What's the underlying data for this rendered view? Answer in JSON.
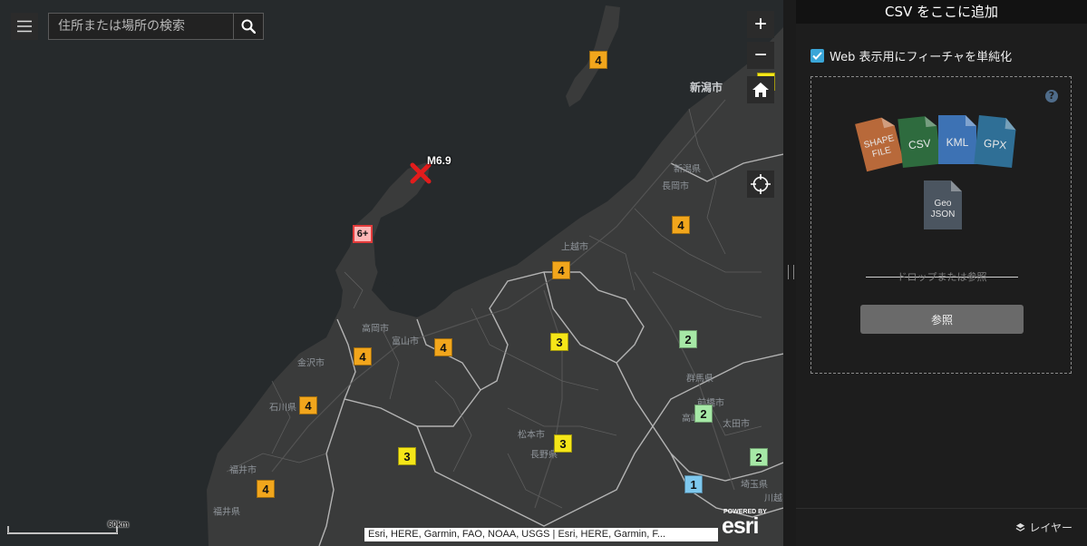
{
  "search": {
    "placeholder": "住所または場所の検索"
  },
  "zoom": {
    "in_label": "+",
    "out_label": "−"
  },
  "earthquake": {
    "magnitude_label": "M6.9"
  },
  "places": [
    {
      "key": "niigata-city",
      "label": "新潟市",
      "big": true
    },
    {
      "key": "niigata-pref",
      "label": "新潟県",
      "big": false
    },
    {
      "key": "nagaoka",
      "label": "長岡市",
      "big": false
    },
    {
      "key": "joetsu",
      "label": "上越市",
      "big": false
    },
    {
      "key": "takaoka",
      "label": "高岡市",
      "big": false
    },
    {
      "key": "toyama",
      "label": "富山市",
      "big": false
    },
    {
      "key": "kanazawa",
      "label": "金沢市",
      "big": false
    },
    {
      "key": "ishikawa",
      "label": "石川県",
      "big": false
    },
    {
      "key": "fukui-city",
      "label": "福井市",
      "big": false
    },
    {
      "key": "fukui-pref",
      "label": "福井県",
      "big": false
    },
    {
      "key": "matsumoto",
      "label": "松本市",
      "big": false
    },
    {
      "key": "nagano-pref",
      "label": "長野県",
      "big": false
    },
    {
      "key": "gunma-pref",
      "label": "群馬県",
      "big": false
    },
    {
      "key": "maebashi",
      "label": "前橋市",
      "big": false
    },
    {
      "key": "takasaki",
      "label": "高崎市",
      "big": false
    },
    {
      "key": "ota",
      "label": "太田市",
      "big": false
    },
    {
      "key": "saitama",
      "label": "埼玉県",
      "big": false
    },
    {
      "key": "kawagoe",
      "label": "川越",
      "big": false
    }
  ],
  "intensity_markers": [
    {
      "label": "4",
      "level": "4"
    },
    {
      "label": "3",
      "level": "3"
    },
    {
      "label": "6+",
      "level": "6+"
    },
    {
      "label": "4",
      "level": "4"
    },
    {
      "label": "4",
      "level": "4"
    },
    {
      "label": "3",
      "level": "3"
    },
    {
      "label": "2",
      "level": "2"
    },
    {
      "label": "4",
      "level": "4"
    },
    {
      "label": "4",
      "level": "4"
    },
    {
      "label": "4",
      "level": "4"
    },
    {
      "label": "4",
      "level": "4"
    },
    {
      "label": "3",
      "level": "3"
    },
    {
      "label": "3",
      "level": "3"
    },
    {
      "label": "2",
      "level": "2"
    },
    {
      "label": "2",
      "level": "2"
    },
    {
      "label": "4",
      "level": "4"
    },
    {
      "label": "1",
      "level": "1"
    }
  ],
  "intensity_colors": {
    "1": "#7ec8ee",
    "2": "#a6e8a6",
    "3": "#f5e618",
    "4": "#f2a61c",
    "6+": "#ffb6b6"
  },
  "scalebar": {
    "label": "60km"
  },
  "attribution": {
    "text": "Esri, HERE, Garmin, FAO, NOAA, USGS | Esri, HERE, Garmin, F..."
  },
  "branding": {
    "powered_by": "POWERED BY",
    "logo_text": "esri"
  },
  "panel": {
    "title": "CSV をここに追加",
    "simplify_label": "Web 表示用にフィーチャを単純化",
    "simplify_checked": true,
    "help_label": "?",
    "file_types": [
      {
        "key": "shapefile",
        "label_line1": "SHAPE",
        "label_line2": "FILE",
        "color": "#b8693a"
      },
      {
        "key": "csv",
        "label_line1": "CSV",
        "label_line2": "",
        "color": "#2e6b3e"
      },
      {
        "key": "kml",
        "label_line1": "KML",
        "label_line2": "",
        "color": "#3d72b4"
      },
      {
        "key": "gpx",
        "label_line1": "GPX",
        "label_line2": "",
        "color": "#2f6f96"
      },
      {
        "key": "geojson",
        "label_line1": "Geo",
        "label_line2": "JSON",
        "color": "#4b5560"
      }
    ],
    "drop_text": "ドロップまたは参照",
    "browse_label": "参照",
    "layers_label": "レイヤー"
  },
  "colors": {
    "sea": "#262a2c",
    "land": "#3a3b3b",
    "border": "#c9c9c9",
    "accent": "#3aa6d8"
  }
}
